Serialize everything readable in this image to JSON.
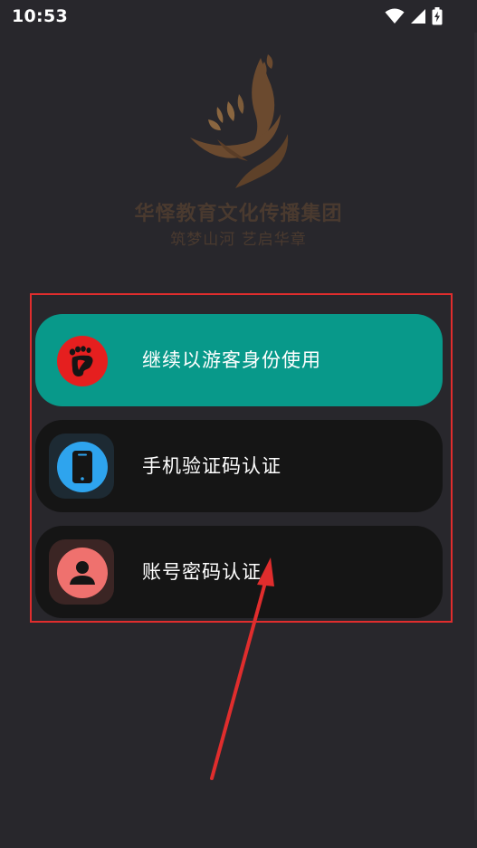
{
  "status_bar": {
    "time": "10:53",
    "icons": [
      "wifi-icon",
      "cellular-signal-icon",
      "battery-charging-icon"
    ]
  },
  "brand": {
    "name": "华怿教育文化传播集团",
    "slogan": "筑梦山河 艺启华章",
    "color": "#4a3a2f",
    "logo_color": "#6b4a2f"
  },
  "login_options": [
    {
      "label": "继续以游客身份使用",
      "icon": "footprint-icon",
      "bg": "#08998a",
      "icon_color": "#e51f1f"
    },
    {
      "label": "手机验证码认证",
      "icon": "phone-icon",
      "bg": "#151515",
      "icon_color": "#2ea4ee"
    },
    {
      "label": "账号密码认证",
      "icon": "user-icon",
      "bg": "#151515",
      "icon_color": "#ef716e"
    }
  ],
  "annotation": {
    "frame_color": "#e02d2d",
    "arrow_color": "#e02d2d"
  }
}
